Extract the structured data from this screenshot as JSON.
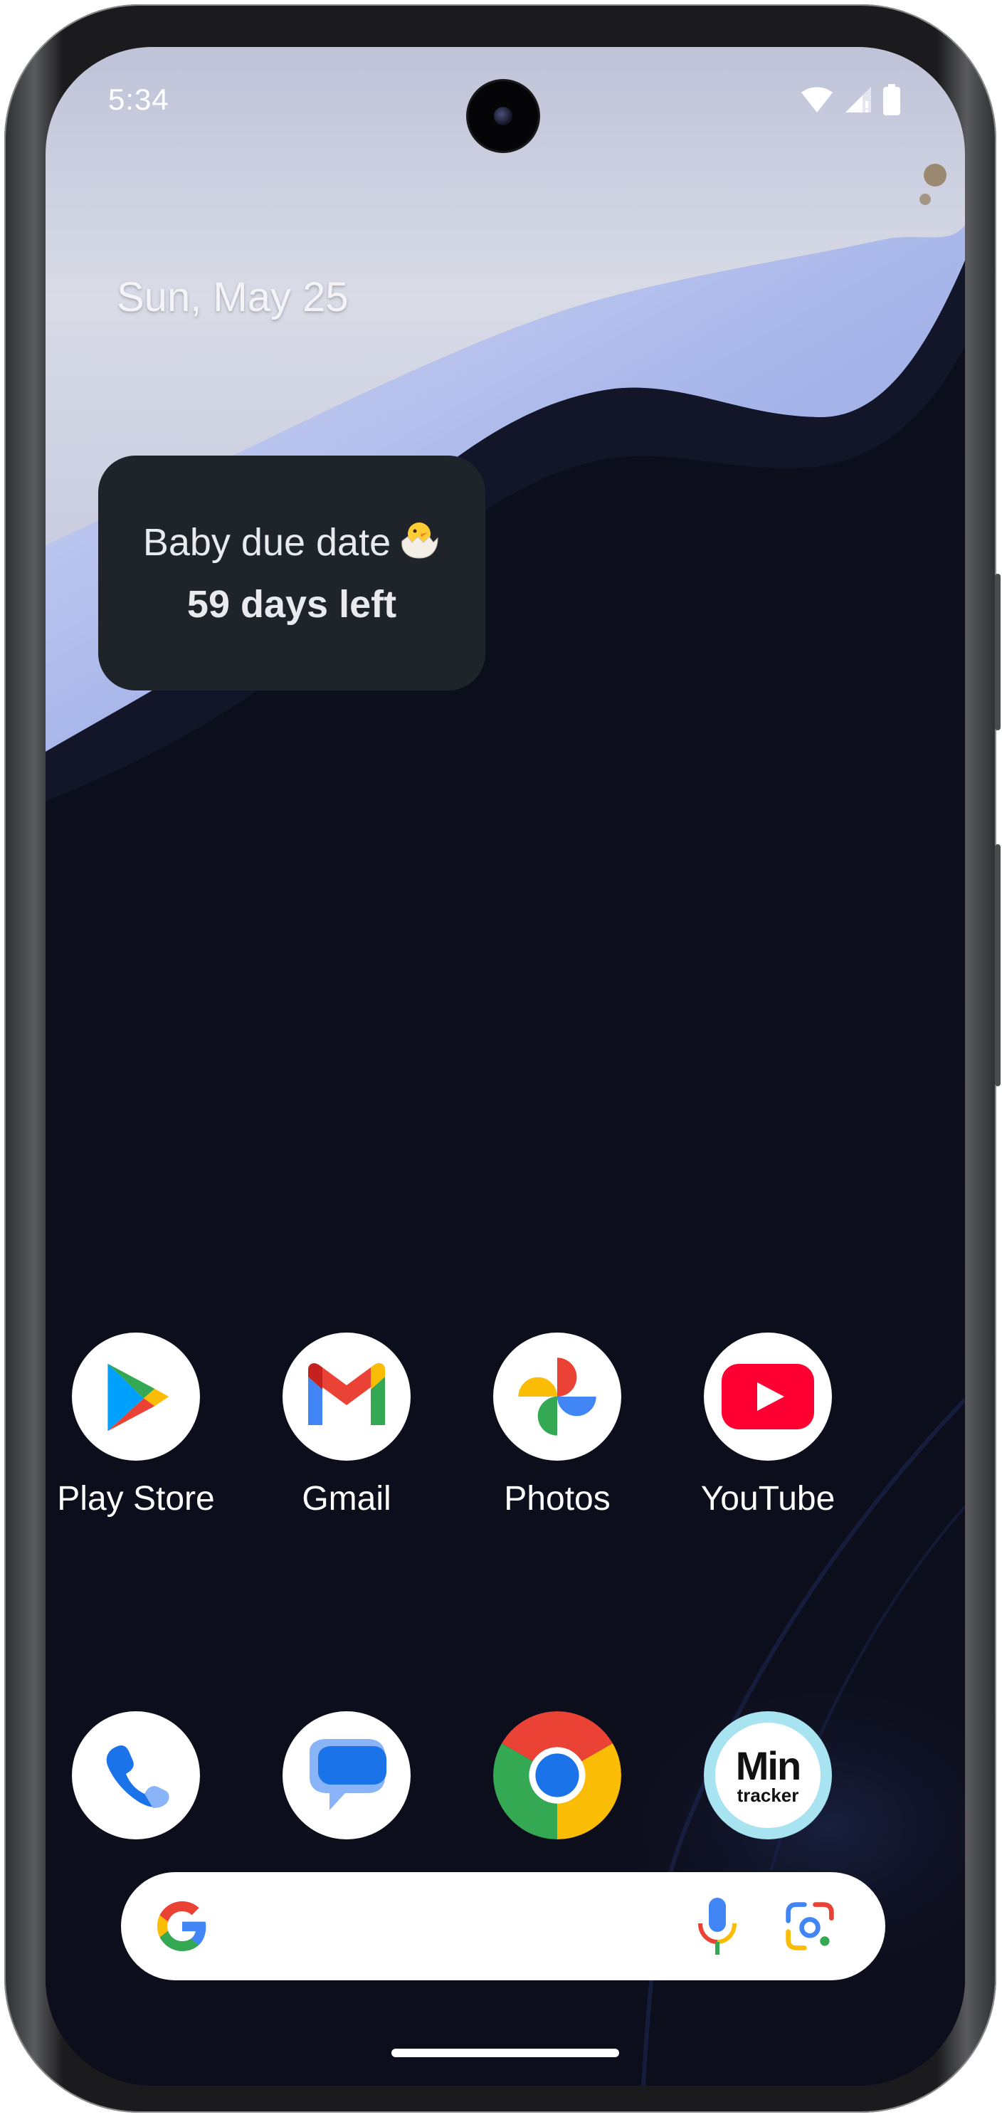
{
  "status_bar": {
    "time": "5:34"
  },
  "home": {
    "date": "Sun, May 25",
    "widget": {
      "title": "Baby due date",
      "countdown": "59 days left"
    }
  },
  "apps_row1": [
    {
      "label": "Play Store",
      "icon": "play-store-icon"
    },
    {
      "label": "Gmail",
      "icon": "gmail-icon"
    },
    {
      "label": "Photos",
      "icon": "photos-icon"
    },
    {
      "label": "YouTube",
      "icon": "youtube-icon"
    }
  ],
  "dock": [
    {
      "icon": "phone-icon"
    },
    {
      "icon": "messages-icon"
    },
    {
      "icon": "chrome-icon"
    },
    {
      "icon": "min-tracker-icon",
      "logo_text": "Min",
      "logo_subtext": "tracker"
    }
  ],
  "search_bar": {
    "icons": [
      "google-g-icon",
      "microphone-icon",
      "google-lens-icon"
    ]
  },
  "colors": {
    "wallpaper_dark": "#0d0e1b",
    "wallpaper_light": "#b9c6ee",
    "widget_bg": "#1f232a",
    "google_blue": "#4285F4",
    "google_red": "#EA4335",
    "google_yellow": "#FBBC05",
    "google_green": "#34A853"
  }
}
